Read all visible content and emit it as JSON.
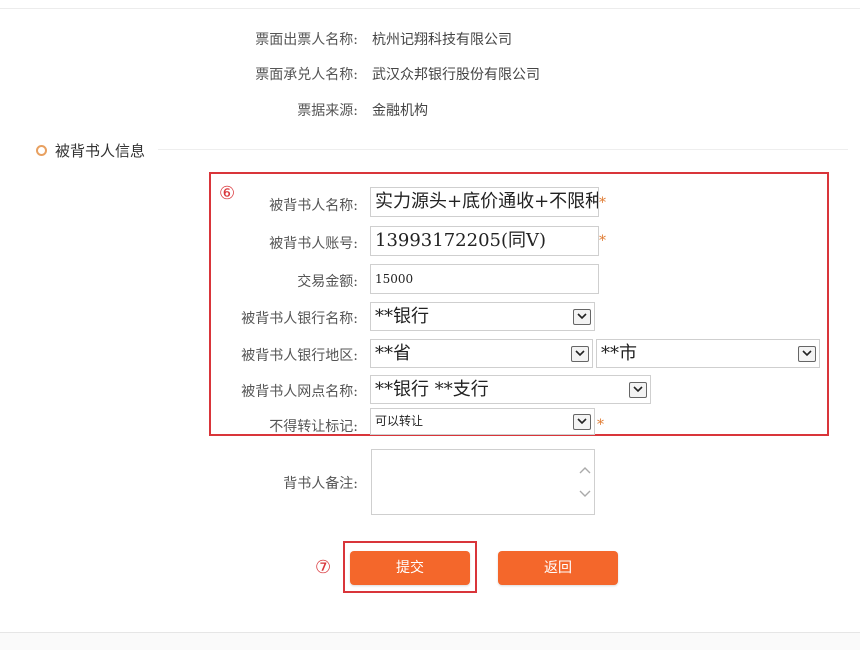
{
  "ticket_info": {
    "issuer_label": "票面出票人名称:",
    "issuer_value": "杭州记翔科技有限公司",
    "acceptor_label": "票面承兑人名称:",
    "acceptor_value": "武汉众邦银行股份有限公司",
    "source_label": "票据来源:",
    "source_value": "金融机构"
  },
  "section": {
    "title": "被背书人信息"
  },
  "annotations": {
    "marker_6": "⑥",
    "marker_7": "⑦"
  },
  "form": {
    "name_label": "被背书人名称:",
    "name_value": "实力源头+底价通收+不限种类",
    "account_label": "被背书人账号:",
    "account_value": "13993172205(同V)",
    "amount_label": "交易金额:",
    "amount_value": "15000",
    "bank_label": "被背书人银行名称:",
    "bank_value": "**银行",
    "region_label": "被背书人银行地区:",
    "province_value": "**省",
    "city_value": "**市",
    "branch_label": "被背书人网点名称:",
    "branch_value": "**银行 **支行",
    "transfer_label": "不得转让标记:",
    "transfer_value": "可以转让",
    "remark_label": "背书人备注:",
    "remark_value": "",
    "required_mark": "*"
  },
  "buttons": {
    "submit": "提交",
    "back": "返回"
  },
  "colors": {
    "accent": "#f4672b",
    "annotation": "#d9353a",
    "required": "#e07a30"
  },
  "icons": {
    "select_arrow": "chevron-down-icon",
    "section_bullet": "circle-bullet-icon"
  }
}
